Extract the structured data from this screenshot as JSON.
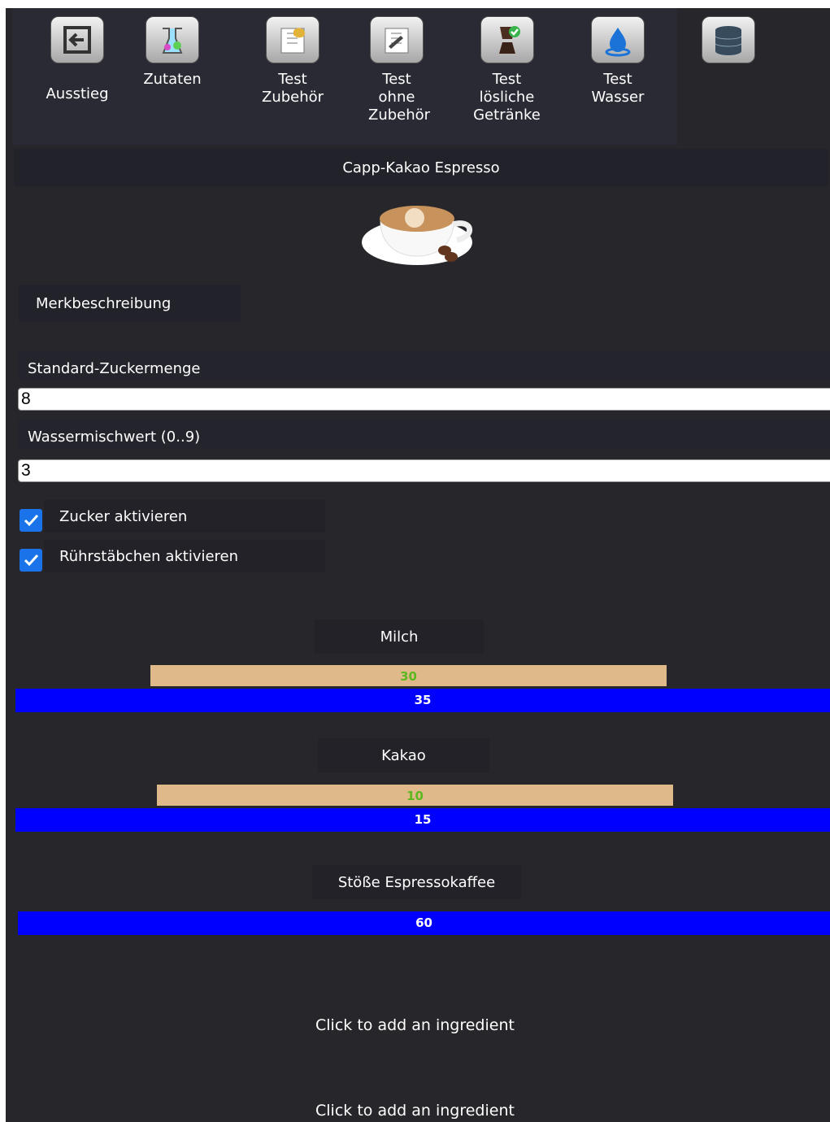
{
  "toolbar": {
    "items": [
      {
        "label": "Ausstieg",
        "icon": "exit-icon"
      },
      {
        "label": "Zutaten",
        "icon": "flasks-icon"
      },
      {
        "label": "Test Zubehör",
        "icon": "test-accessories-icon"
      },
      {
        "label": "Test ohne Zubehör",
        "icon": "test-without-accessories-icon"
      },
      {
        "label": "Test lösliche Getränke",
        "icon": "soluble-drinks-icon"
      },
      {
        "label": "Test Wasser",
        "icon": "water-drop-icon"
      },
      {
        "label": "",
        "icon": "database-icon"
      }
    ]
  },
  "product": {
    "title": "Capp-Kakao Espresso",
    "description_label": "Merkbeschreibung"
  },
  "fields": {
    "sugar_label": "Standard-Zuckermenge",
    "sugar_value": "8",
    "water_label": "Wassermischwert (0..9)",
    "water_value": "3"
  },
  "checks": {
    "sugar_label": "Zucker aktivieren",
    "sugar_checked": true,
    "stir_label": "Rührstäbchen aktivieren",
    "stir_checked": true
  },
  "ingredients": [
    {
      "name": "Milch",
      "tan_value": "30",
      "blue_value": "35"
    },
    {
      "name": "Kakao",
      "tan_value": "10",
      "blue_value": "15"
    },
    {
      "name": "Stöße Espressokaffee",
      "blue_value": "60"
    }
  ],
  "add_ingredient": [
    "Click to add an ingredient",
    "Click to add an ingredient"
  ],
  "colors": {
    "background": "#27262b",
    "bar_tan": "#dfb98a",
    "bar_blue": "#0000ff",
    "checkbox": "#1a73e8",
    "tan_text": "#5cb81e"
  }
}
